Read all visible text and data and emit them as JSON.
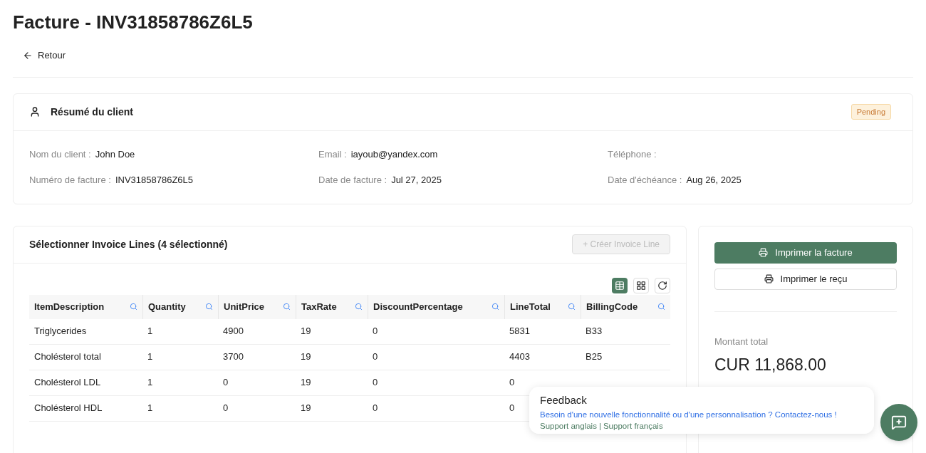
{
  "title": "Facture - INV31858786Z6L5",
  "back_link": "Retour",
  "client_summary": {
    "heading": "Résumé du client",
    "status": "Pending",
    "fields": [
      {
        "label": "Nom du client :",
        "value": "John Doe"
      },
      {
        "label": "Email :",
        "value": "iayoub@yandex.com"
      },
      {
        "label": "Téléphone :"
      },
      {
        "label": "Numéro de facture :",
        "value": "INV31858786Z6L5"
      },
      {
        "label": "Date de facture :",
        "value": "Jul 27, 2025"
      },
      {
        "label": "Date d'échéance :",
        "value": "Aug 26, 2025"
      }
    ]
  },
  "invoice_lines": {
    "heading": "Sélectionner Invoice Lines (4 sélectionné)",
    "create_button": {
      "label": "+ Créer Invoice Line",
      "disabled": true
    },
    "view_toggles": [
      {
        "kind": "table",
        "selected": true
      },
      {
        "kind": "grid",
        "selected": false
      },
      {
        "kind": "refresh",
        "selected": false
      }
    ],
    "columns": [
      "ItemDescription",
      "Quantity",
      "UnitPrice",
      "TaxRate",
      "DiscountPercentage",
      "LineTotal",
      "BillingCode"
    ],
    "rows": [
      [
        "Triglycerides",
        "1",
        "4900",
        "19",
        "0",
        "5831",
        "B33"
      ],
      [
        "Cholésterol total",
        "1",
        "3700",
        "19",
        "0",
        "4403",
        "B25"
      ],
      [
        "Cholésterol LDL",
        "1",
        "0",
        "19",
        "0",
        "0"
      ],
      [
        "Cholésterol HDL",
        "1",
        "0",
        "19",
        "0",
        "0"
      ]
    ]
  },
  "summary": {
    "print_invoice": "Imprimer la facture",
    "print_receipt": "Imprimer le reçu",
    "total_label": "Montant total",
    "total_value": "CUR 11,868.00"
  },
  "feedback": {
    "title": "Feedback",
    "message": "Besoin d'une nouvelle fonctionnalité ou d'une personnalisation ? Contactez-nous !",
    "links": [
      "Support anglais",
      "Support français"
    ],
    "separator": "|"
  }
}
